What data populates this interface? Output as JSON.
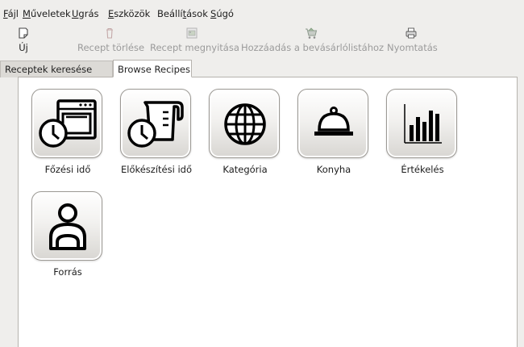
{
  "menubar": {
    "items": [
      {
        "accel": "F",
        "rest": "ájl"
      },
      {
        "accel": "M",
        "rest": "űveletek"
      },
      {
        "accel": "U",
        "rest": "grás"
      },
      {
        "accel": "E",
        "rest": "szközök"
      },
      {
        "pre": "Beállí",
        "accel": "t",
        "rest": "ások"
      },
      {
        "accel": "S",
        "rest": "úgó"
      }
    ]
  },
  "toolbar": {
    "new_label": "Új",
    "delete_label": "Recept törlése",
    "open_label": "Recept megnyitása",
    "add_shopping_label": "Hozzáadás a bevásárlólistához",
    "print_label": "Nyomtatás"
  },
  "tabs": {
    "search_label": "Receptek keresése",
    "browse_label": "Browse Recipes"
  },
  "browse": {
    "tiles": [
      {
        "label": "Főzési idő",
        "icon": "oven-clock-icon"
      },
      {
        "label": "Előkészítési idő",
        "icon": "measuring-cup-clock-icon"
      },
      {
        "label": "Kategória",
        "icon": "globe-icon"
      },
      {
        "label": "Konyha",
        "icon": "serving-dome-icon"
      },
      {
        "label": "Értékelés",
        "icon": "bar-chart-icon"
      },
      {
        "label": "Forrás",
        "icon": "person-icon"
      }
    ]
  }
}
